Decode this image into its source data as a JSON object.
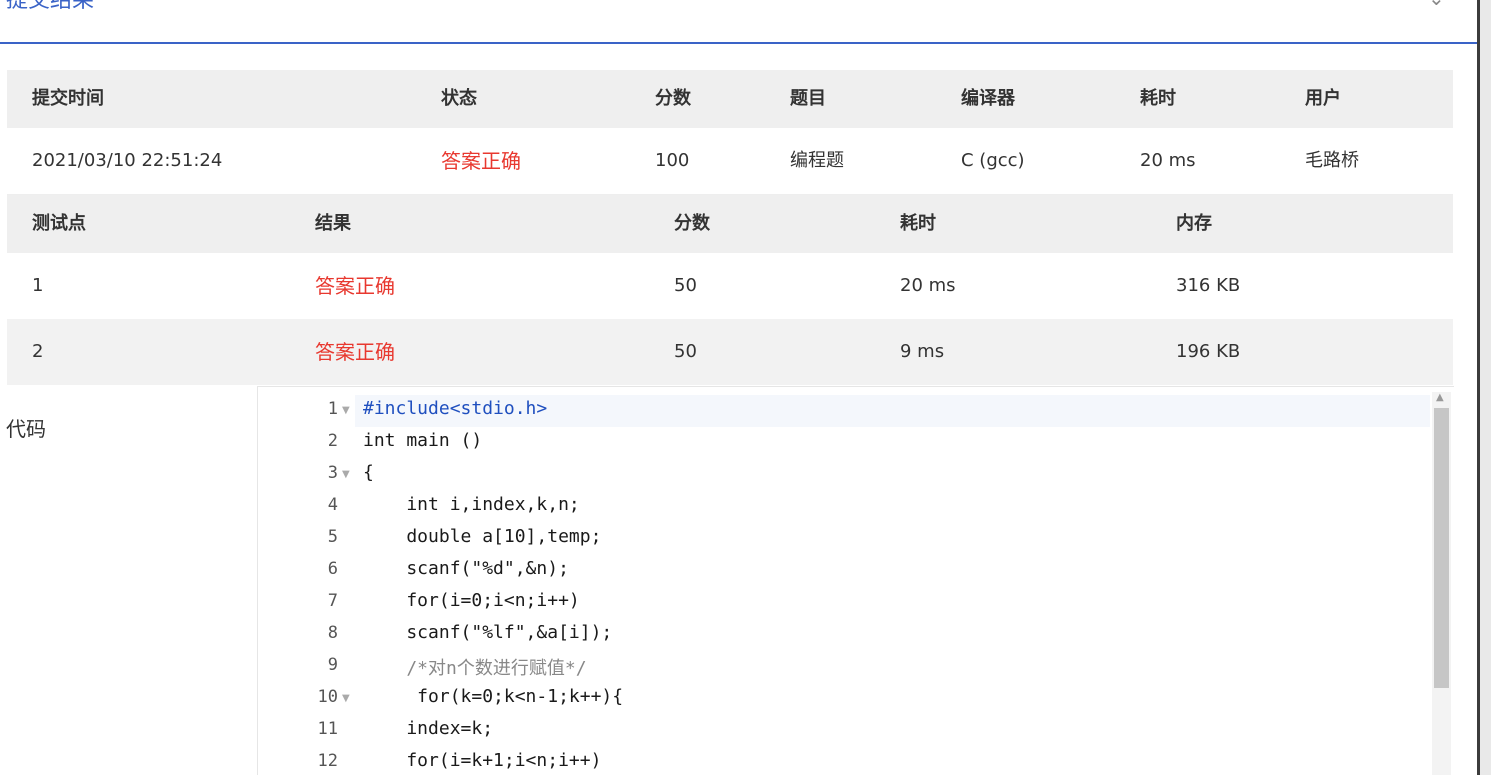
{
  "dialog": {
    "title": "提交结果",
    "close_icon": "close-icon"
  },
  "summary": {
    "headers": [
      "提交时间",
      "状态",
      "分数",
      "题目",
      "编译器",
      "耗时",
      "用户"
    ],
    "row": [
      "2021/03/10 22:51:24",
      "答案正确",
      "100",
      "编程题",
      "C (gcc)",
      "20 ms",
      "毛路桥"
    ]
  },
  "tests": {
    "headers": [
      "测试点",
      "结果",
      "分数",
      "耗时",
      "内存"
    ],
    "rows": [
      [
        "1",
        "答案正确",
        "50",
        "20 ms",
        "316 KB"
      ],
      [
        "2",
        "答案正确",
        "50",
        "9 ms",
        "196 KB"
      ]
    ]
  },
  "code_label": "代码",
  "code": {
    "line_numbers": [
      "1",
      "2",
      "3",
      "4",
      "5",
      "6",
      "7",
      "8",
      "9",
      "10",
      "11",
      "12"
    ],
    "lines": [
      "#include<stdio.h>",
      "int main ()",
      "{",
      "    int i,index,k,n;",
      "    double a[10],temp;",
      "    scanf(\"%d\",&n);",
      "    for(i=0;i<n;i++)",
      "    scanf(\"%lf\",&a[i]);",
      "    /*对n个数进行赋值*/",
      "     for(k=0;k<n-1;k++){",
      "    index=k;",
      "    for(i=k+1;i<n;i++)"
    ]
  },
  "colors": {
    "accent": "#3a63c7",
    "ok": "#e8382f",
    "header_bg": "#efefef"
  }
}
